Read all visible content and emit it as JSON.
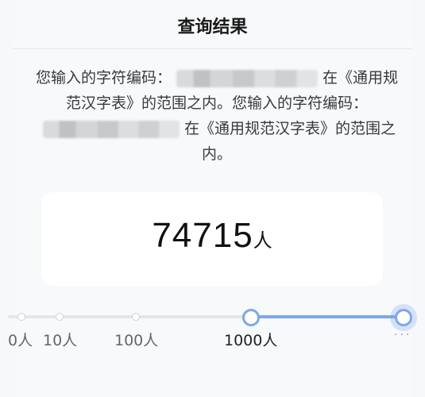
{
  "header": {
    "title": "查询结果"
  },
  "description": {
    "part1": "您输入的字符编码：",
    "part2": "在《通用规范汉字表》的范围之内。您输入的字符编码：",
    "part3": "在《通用规范汉字表》的范围之内。"
  },
  "result": {
    "count": "74715",
    "unit": "人"
  },
  "scale": {
    "ticks": [
      "0人",
      "10人",
      "100人",
      "1000人"
    ],
    "selected": "1000人",
    "more_label": "···"
  },
  "colors": {
    "accent": "#7da7ea",
    "track": "#e4e6e9"
  }
}
